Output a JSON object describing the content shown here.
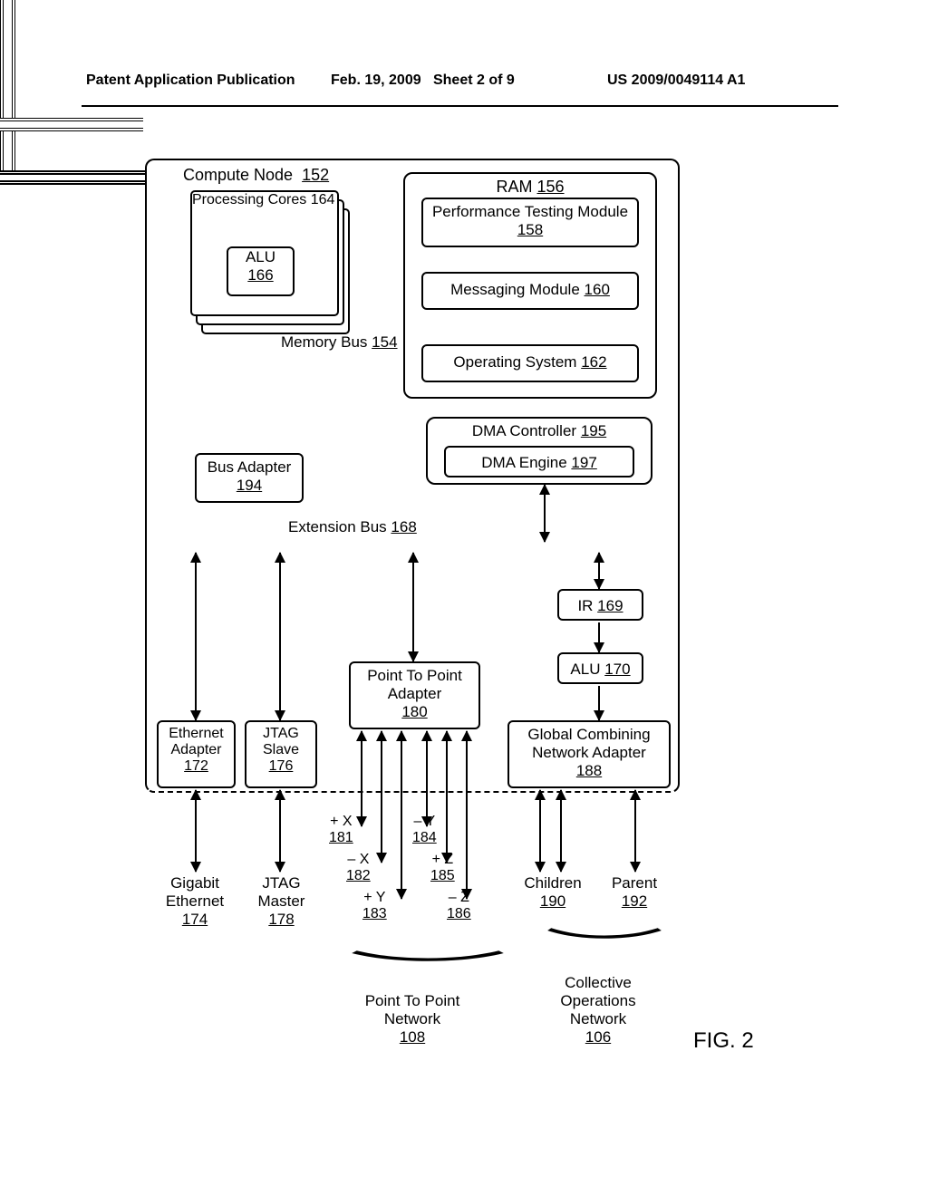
{
  "header": {
    "left": "Patent Application Publication",
    "mid_date": "Feb. 19, 2009",
    "mid_sheet": "Sheet 2 of 9",
    "right": "US 2009/0049114 A1"
  },
  "compute_node": {
    "label": "Compute Node",
    "ref": "152"
  },
  "processing_cores": {
    "label": "Processing Cores",
    "ref": "164"
  },
  "alu1": {
    "label": "ALU",
    "ref": "166"
  },
  "ram": {
    "label": "RAM",
    "ref": "156"
  },
  "perf": {
    "label": "Performance Testing Module",
    "ref": "158"
  },
  "msg": {
    "label": "Messaging Module",
    "ref": "160"
  },
  "os": {
    "label": "Operating System",
    "ref": "162"
  },
  "dma": {
    "label": "DMA Controller",
    "ref": "195"
  },
  "dmaeng": {
    "label": "DMA Engine",
    "ref": "197"
  },
  "memory_bus": {
    "label": "Memory Bus",
    "ref": "154"
  },
  "bus_adapter": {
    "label": "Bus Adapter",
    "ref": "194"
  },
  "extension_bus": {
    "label": "Extension Bus",
    "ref": "168"
  },
  "ir": {
    "label": "IR",
    "ref": "169"
  },
  "alu2": {
    "label": "ALU",
    "ref": "170"
  },
  "eth": {
    "label": "Ethernet Adapter",
    "ref": "172"
  },
  "jtag": {
    "label": "JTAG Slave",
    "ref": "176"
  },
  "ptp": {
    "label": "Point To Point Adapter",
    "ref": "180"
  },
  "gcn": {
    "label": "Global Combining Network Adapter",
    "ref": "188"
  },
  "gige": {
    "label": "Gigabit Ethernet",
    "ref": "174"
  },
  "jtagm": {
    "label": "JTAG Master",
    "ref": "178"
  },
  "children": {
    "label": "Children",
    "ref": "190"
  },
  "parent": {
    "label": "Parent",
    "ref": "192"
  },
  "dirs": {
    "px": {
      "label": "+ X",
      "ref": "181"
    },
    "nx": {
      "label": "– X",
      "ref": "182"
    },
    "py": {
      "label": "+ Y",
      "ref": "183"
    },
    "ny": {
      "label": "– Y",
      "ref": "184"
    },
    "pz": {
      "label": "+ Z",
      "ref": "185"
    },
    "nz": {
      "label": "– Z",
      "ref": "186"
    }
  },
  "net_ptp": {
    "label": "Point To Point Network",
    "ref": "108"
  },
  "net_col": {
    "label": "Collective Operations Network",
    "ref": "106"
  },
  "figure": "FIG. 2"
}
